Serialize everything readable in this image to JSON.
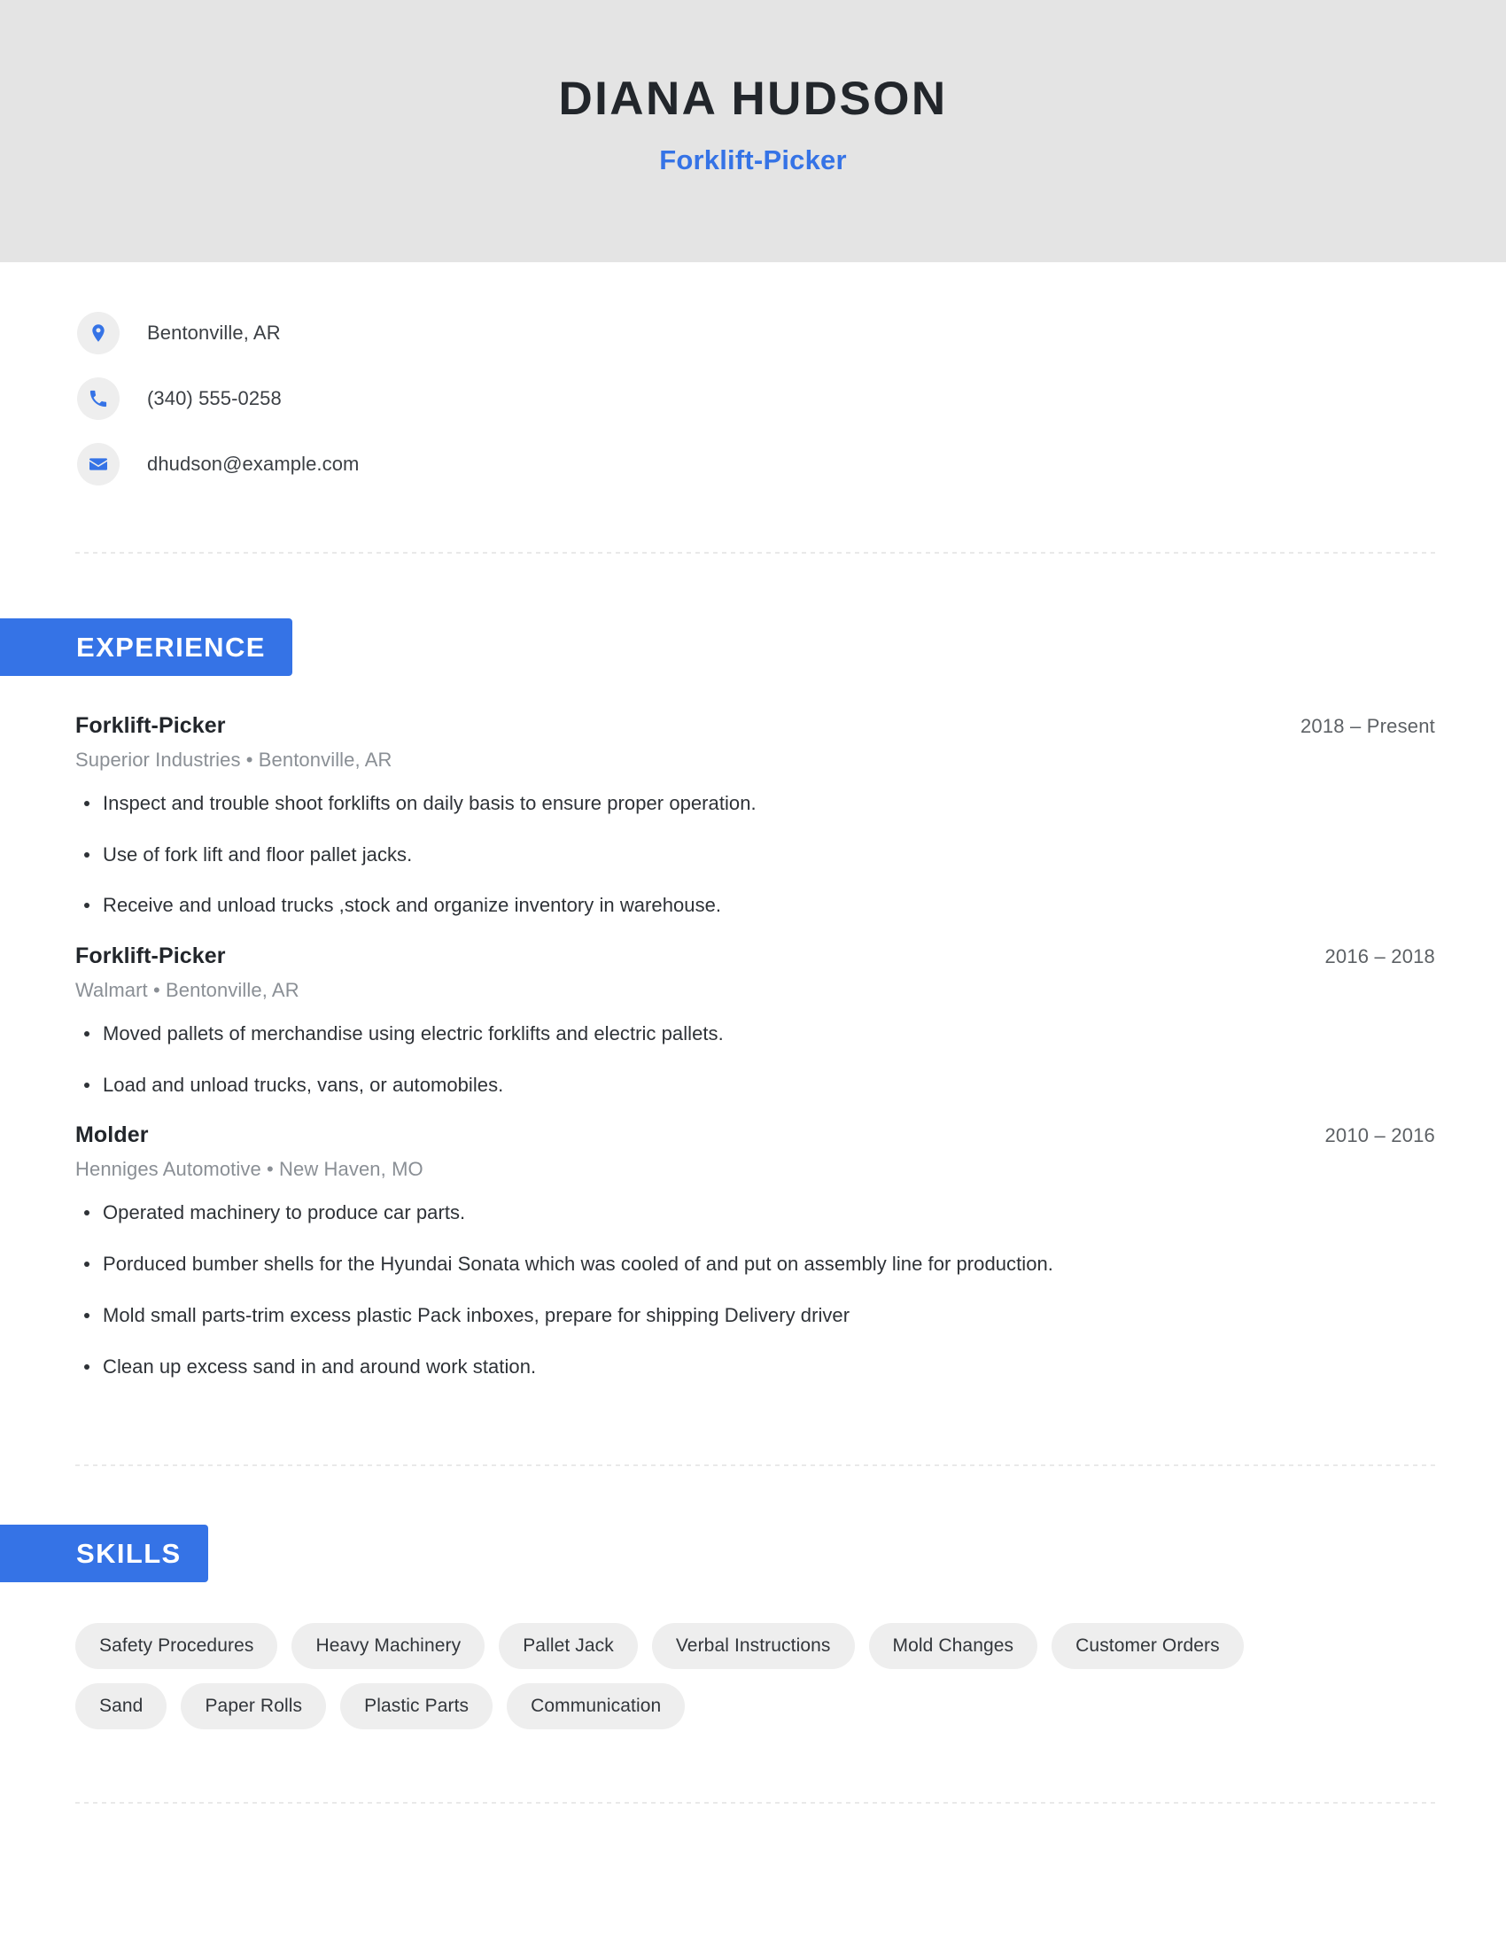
{
  "theme": {
    "accent": "#3573e6",
    "header_bg": "#e4e4e4",
    "pill_bg": "#eeeeee",
    "text_dark": "#22262b",
    "text_muted": "#8a8f95"
  },
  "header": {
    "name": "DIANA HUDSON",
    "title": "Forklift-Picker"
  },
  "contact": {
    "items": [
      {
        "icon": "location-pin-icon",
        "value": "Bentonville, AR"
      },
      {
        "icon": "phone-icon",
        "value": "(340) 555-0258"
      },
      {
        "icon": "email-icon",
        "value": "dhudson@example.com"
      }
    ]
  },
  "experience": {
    "section_label": "EXPERIENCE",
    "jobs": [
      {
        "role": "Forklift-Picker",
        "dates": "2018 – Present",
        "company": "Superior Industries",
        "separator": "•",
        "location": "Bentonville, AR",
        "meta": "Superior Industries  •  Bentonville, AR",
        "bullets": [
          "Inspect and trouble shoot forklifts on daily basis to ensure proper operation.",
          "Use of fork lift and floor pallet jacks.",
          "Receive and unload trucks ,stock and organize inventory in warehouse."
        ]
      },
      {
        "role": "Forklift-Picker",
        "dates": "2016 – 2018",
        "company": "Walmart",
        "separator": "•",
        "location": "Bentonville, AR",
        "meta": "Walmart  •  Bentonville, AR",
        "bullets": [
          "Moved pallets of merchandise using electric forklifts and electric pallets.",
          "Load and unload trucks, vans, or automobiles."
        ]
      },
      {
        "role": "Molder",
        "dates": "2010 – 2016",
        "company": "Henniges Automotive",
        "separator": "•",
        "location": "New Haven, MO",
        "meta": "Henniges Automotive  •  New Haven, MO",
        "bullets": [
          "Operated machinery to produce car parts.",
          "Porduced bumber shells for the Hyundai Sonata which was cooled of and put on assembly line for production.",
          "Mold small parts-trim excess plastic Pack inboxes, prepare for shipping Delivery driver",
          "Clean up excess sand in and around work station."
        ]
      }
    ]
  },
  "skills": {
    "section_label": "SKILLS",
    "items": [
      "Safety Procedures",
      "Heavy Machinery",
      "Pallet Jack",
      "Verbal Instructions",
      "Mold Changes",
      "Customer Orders",
      "Sand",
      "Paper Rolls",
      "Plastic Parts",
      "Communication"
    ]
  }
}
